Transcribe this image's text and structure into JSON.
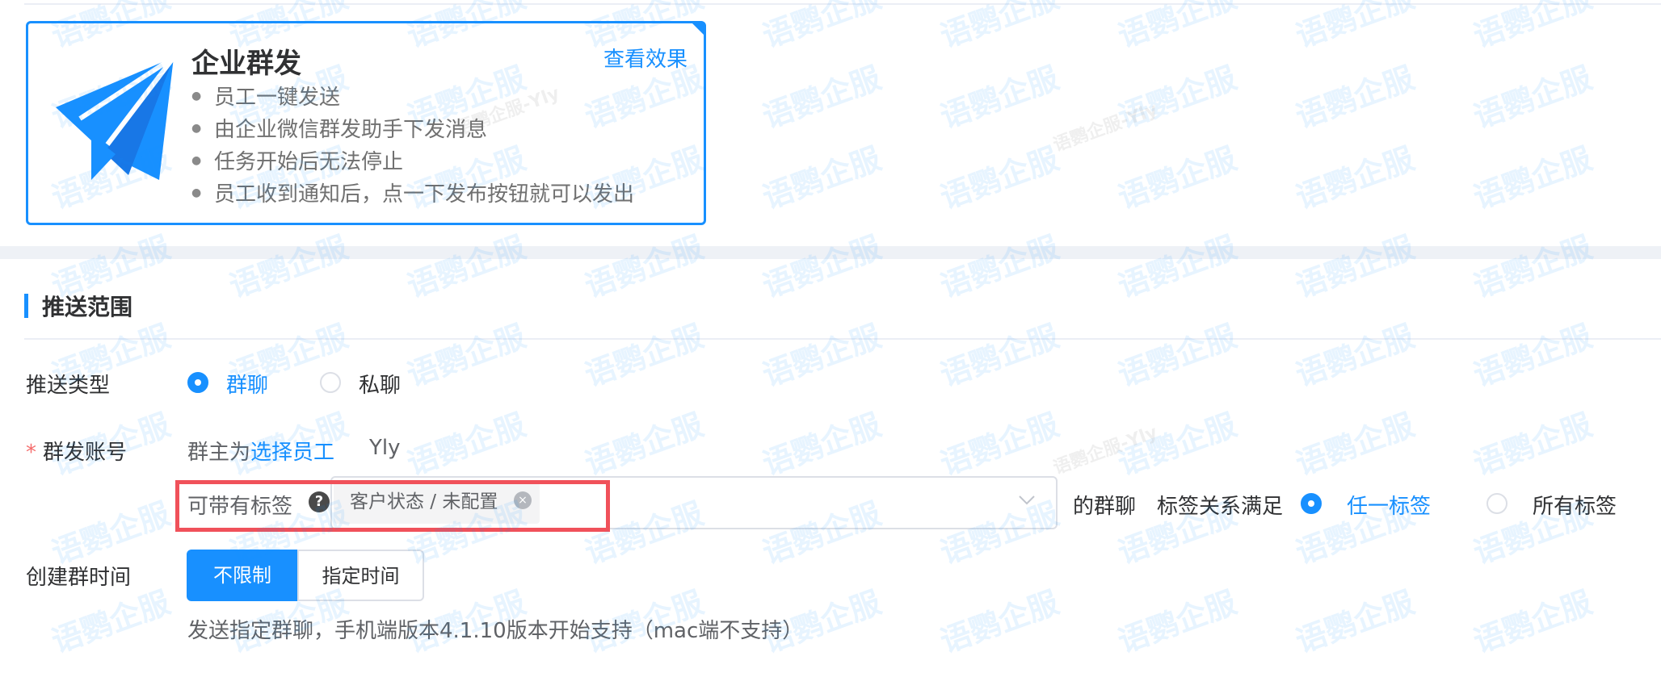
{
  "feature_card": {
    "title": "企业群发",
    "view_effect_link": "查看效果",
    "bullets": [
      "员工一键发送",
      "由企业微信群发助手下发消息",
      "任务开始后无法停止",
      "员工收到通知后，点一下发布按钮就可以发出"
    ],
    "icon": "paper-plane-icon"
  },
  "push_scope": {
    "section_title": "推送范围",
    "push_type": {
      "label": "推送类型",
      "options": [
        "群聊",
        "私聊"
      ],
      "selected": "群聊"
    },
    "group_account": {
      "required_mark": "*",
      "label": "群发账号",
      "owner_prefix": "群主为",
      "select_staff_link": "选择员工",
      "selected_staff": "Yly",
      "tag_filter_label": "可带有标签",
      "help_icon_text": "?",
      "selected_tag": "客户状态 / 未配置",
      "tag_close_glyph": "×",
      "suffix_text": "的群聊",
      "relation_label": "标签关系满足",
      "relation_options": [
        "任一标签",
        "所有标签"
      ],
      "relation_selected": "任一标签"
    },
    "create_time": {
      "label": "创建群时间",
      "buttons": [
        "不限制",
        "指定时间"
      ],
      "selected": "不限制",
      "hint": "发送指定群聊，手机端版本4.1.10版本开始支持（mac端不支持）"
    }
  },
  "watermark": {
    "text": "语鹦企服",
    "sub_text": "语鹦企服-Yly"
  },
  "colors": {
    "accent": "#1890ff",
    "highlight": "#f0515a"
  }
}
